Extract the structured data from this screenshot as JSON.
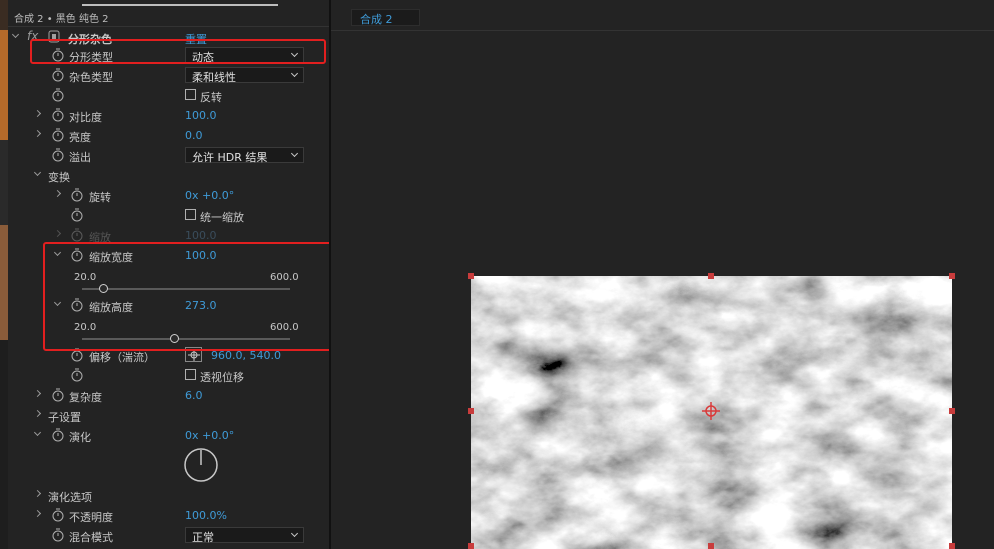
{
  "breadcrumb": "合成 2 • 黑色 纯色 2",
  "effect": {
    "fx_label": "fx",
    "name": "分形杂色",
    "reset": "重置"
  },
  "rows": {
    "fractal_type": {
      "label": "分形类型",
      "value": "动态"
    },
    "noise_type": {
      "label": "杂色类型",
      "value": "柔和线性"
    },
    "invert": {
      "label": "反转"
    },
    "contrast": {
      "label": "对比度",
      "value": "100.0"
    },
    "brightness": {
      "label": "亮度",
      "value": "0.0"
    },
    "overflow": {
      "label": "溢出",
      "value": "允许 HDR 结果"
    },
    "transform": {
      "label": "变换"
    },
    "rotation": {
      "label": "旋转",
      "value": "0x +0.0°"
    },
    "uniform_scale": {
      "label": "统一缩放"
    },
    "scale": {
      "label": "缩放",
      "value": "100.0"
    },
    "scale_width": {
      "label": "缩放宽度",
      "value": "100.0",
      "min": "20.0",
      "max": "600.0",
      "fraction": 0.1
    },
    "scale_height": {
      "label": "缩放高度",
      "value": "273.0",
      "min": "20.0",
      "max": "600.0",
      "fraction": 0.44
    },
    "offset": {
      "label": "偏移（湍流）",
      "value": "960.0, 540.0"
    },
    "perspective": {
      "label": "透视位移"
    },
    "complexity": {
      "label": "复杂度",
      "value": "6.0"
    },
    "sub_settings": {
      "label": "子设置"
    },
    "evolution": {
      "label": "演化",
      "value": "0x +0.0°"
    },
    "evolution_options": {
      "label": "演化选项"
    },
    "opacity": {
      "label": "不透明度",
      "value": "100.0%"
    },
    "blend_mode": {
      "label": "混合模式",
      "value": "正常"
    }
  },
  "composition": {
    "tab": "合成 2"
  }
}
